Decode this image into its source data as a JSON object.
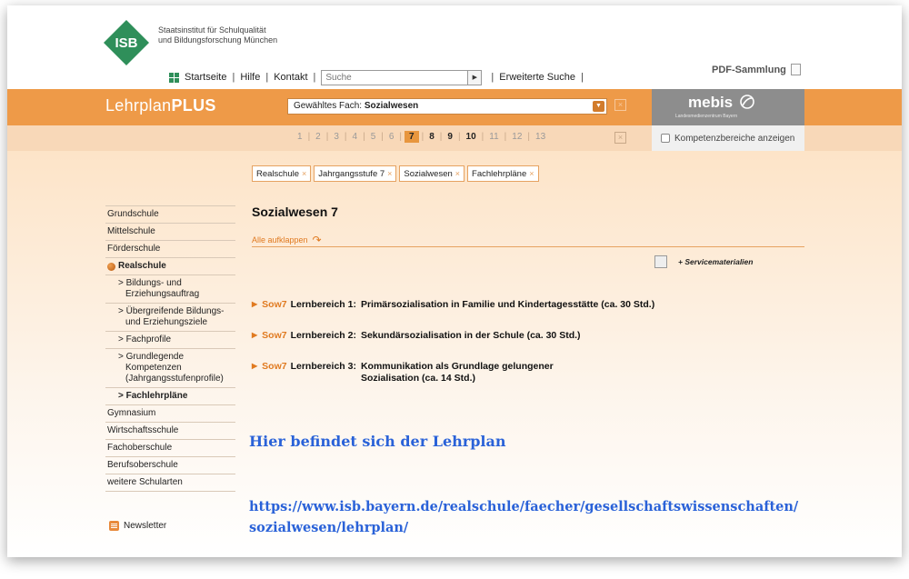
{
  "header": {
    "logo_text": "ISB",
    "institute_line1": "Staatsinstitut für Schulqualität",
    "institute_line2": "und Bildungsforschung München",
    "nav": {
      "home": "Startseite",
      "help": "Hilfe",
      "contact": "Kontakt",
      "search_placeholder": "Suche",
      "advanced_search": "Erweiterte Suche"
    },
    "pdf_collection": "PDF-Sammlung"
  },
  "band": {
    "brand_light": "Lehrplan",
    "brand_bold": "PLUS",
    "subject_prefix": "Gewähltes Fach: ",
    "subject_value": "Sozialwesen",
    "mebis_title": "mebis",
    "mebis_subtitle": "Landesmedienzentrum Bayern"
  },
  "grades": {
    "items": [
      "1",
      "2",
      "3",
      "4",
      "5",
      "6",
      "7",
      "8",
      "9",
      "10",
      "11",
      "12",
      "13"
    ],
    "active": "7",
    "bold": [
      "8",
      "9",
      "10"
    ],
    "kompetenz_label": "Kompetenzbereiche anzeigen"
  },
  "breadcrumbs": [
    "Realschule",
    "Jahrgangsstufe 7",
    "Sozialwesen",
    "Fachlehrpläne"
  ],
  "sidebar": {
    "items": [
      {
        "label": "Grundschule",
        "type": "top"
      },
      {
        "label": "Mittelschule",
        "type": "top"
      },
      {
        "label": "Förderschule",
        "type": "top"
      },
      {
        "label": "Realschule",
        "type": "active"
      },
      {
        "label": "> Bildungs- und Erziehungsauftrag",
        "type": "sub"
      },
      {
        "label": "> Übergreifende Bildungs- und Erziehungsziele",
        "type": "sub"
      },
      {
        "label": "> Fachprofile",
        "type": "sub"
      },
      {
        "label": "> Grundlegende Kompetenzen (Jahrgangsstufenprofile)",
        "type": "sub"
      },
      {
        "label": "> Fachlehrpläne",
        "type": "sub-strong"
      },
      {
        "label": "Gymnasium",
        "type": "top"
      },
      {
        "label": "Wirtschaftsschule",
        "type": "top"
      },
      {
        "label": "Fachoberschule",
        "type": "top"
      },
      {
        "label": "Berufsoberschule",
        "type": "top"
      },
      {
        "label": "weitere Schularten",
        "type": "top"
      }
    ],
    "newsletter": "Newsletter"
  },
  "main": {
    "title": "Sozialwesen 7",
    "expand_all": "Alle aufklappen",
    "service_materials": "+ Servicematerialien",
    "lernbereiche": [
      {
        "code": "Sow7",
        "number": "Lernbereich 1:",
        "title": "Primärsozialisation in Familie und Kindertagesstätte (ca. 30 Std.)"
      },
      {
        "code": "Sow7",
        "number": "Lernbereich 2:",
        "title": "Sekundärsozialisation in der Schule (ca. 30 Std.)"
      },
      {
        "code": "Sow7",
        "number": "Lernbereich 3:",
        "title": "Kommunikation als Grundlage gelungener Sozialisation (ca. 14 Std.)"
      }
    ]
  },
  "overlay": {
    "note": "Hier befindet sich der Lehrplan",
    "url_line1": "https://www.isb.bayern.de/realschule/faecher/gesellschaftswissenschaften/",
    "url_line2": "sozialwesen/lehrplan/"
  },
  "colors": {
    "accent_orange": "#ee9a48",
    "link_orange": "#e07a20",
    "isb_green": "#2f8f5a",
    "overlay_blue": "#2a62d8"
  }
}
